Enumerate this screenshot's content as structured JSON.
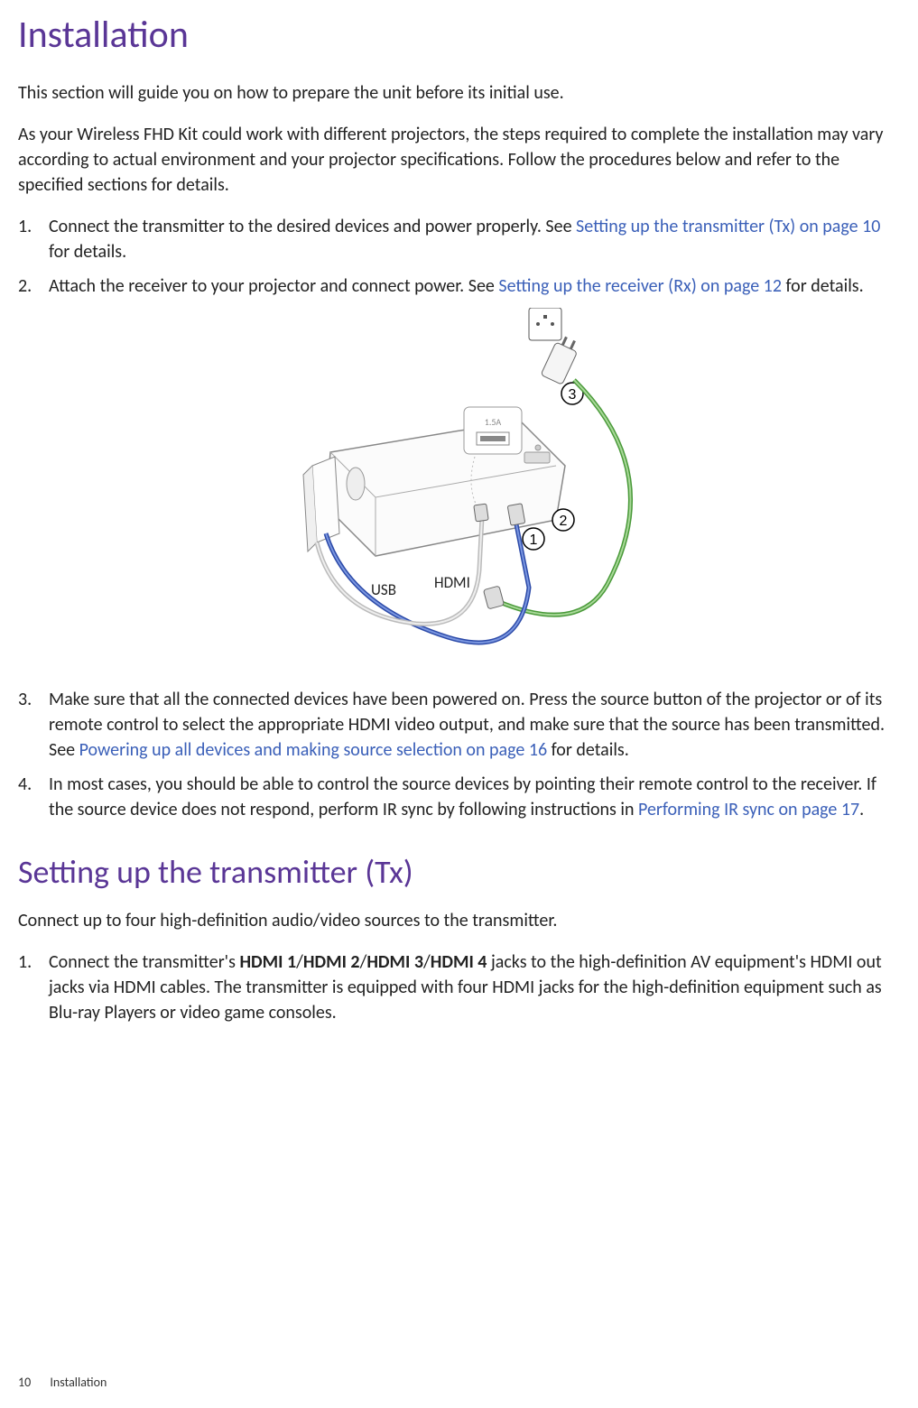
{
  "title": "Installation",
  "intro1": "This section will guide you on how to prepare the unit before its initial use.",
  "intro2": "As your Wireless FHD Kit could work with different projectors, the steps required to complete the installation may vary according to actual environment and your projector specifications. Follow the procedures below and refer to the specified sections for details.",
  "steps": {
    "s1a": "Connect the transmitter to the desired devices and power properly. See ",
    "s1link": "Setting up the transmitter (Tx) on page 10",
    "s1b": " for details.",
    "s2a": "Attach the receiver to your projector and connect power. See ",
    "s2link": "Setting up the receiver (Rx) on page 12",
    "s2b": " for details.",
    "s3a": "Make sure that all the connected devices have been powered on. Press the source button of the projector or of its remote control to select the appropriate HDMI video output, and make sure that the source has been transmitted. See ",
    "s3link": "Powering up all devices and making source selection on page 16",
    "s3b": " for details.",
    "s4a": "In most cases, you should be able to control the source devices by pointing their remote control to the receiver. If the source device does not respond, perform IR sync by following instructions in ",
    "s4link": "Performing IR sync on page 17",
    "s4b": "."
  },
  "figure": {
    "usb_label": "USB",
    "hdmi_label": "HDMI",
    "usb_port_label": "1.5A",
    "callouts": {
      "c1": "1",
      "c2": "2",
      "c3": "3"
    }
  },
  "section2_title": "Setting up the transmitter (Tx)",
  "section2_intro": "Connect up to four high-definition audio/video sources to the transmitter.",
  "section2_step1": {
    "a": "Connect the transmitter's ",
    "b1": "HDMI 1",
    "sep": "/",
    "b2": "HDMI 2",
    "b3": "HDMI 3",
    "b4": "HDMI 4",
    "c": " jacks to the high-definition AV equipment's HDMI out jacks via HDMI cables. The transmitter is equipped with four HDMI jacks for the high-definition equipment such as Blu-ray Players or video game consoles."
  },
  "footer": {
    "page": "10",
    "section": "Installation"
  }
}
